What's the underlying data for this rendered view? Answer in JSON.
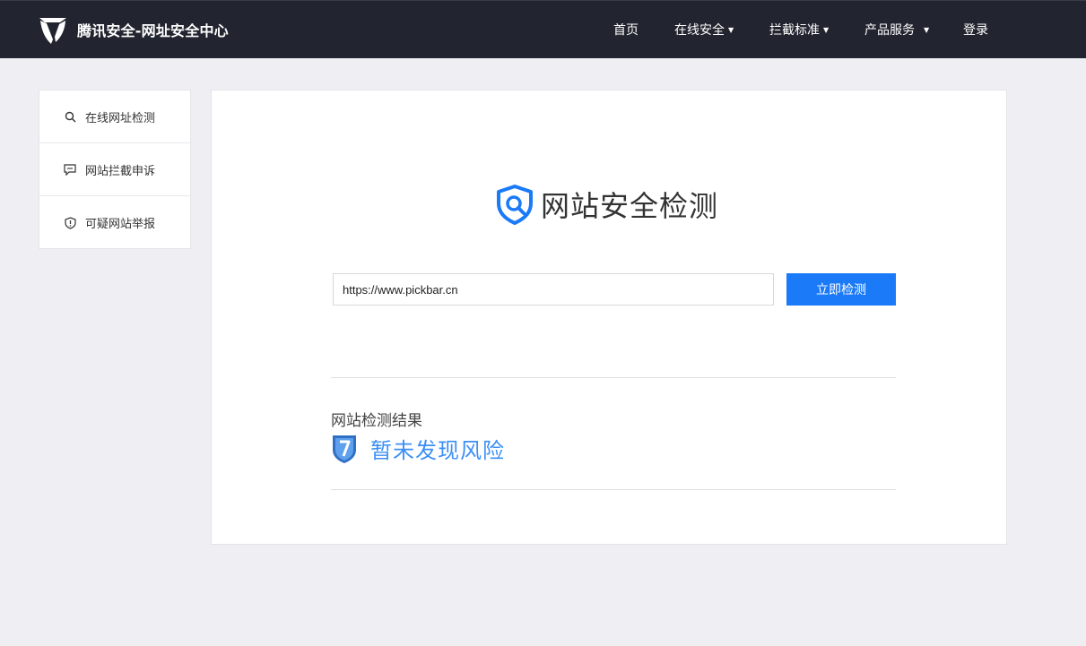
{
  "header": {
    "brand_title": "腾讯安全-网址安全中心",
    "nav": [
      {
        "label": "首页",
        "has_caret": false
      },
      {
        "label": "在线安全",
        "has_caret": true
      },
      {
        "label": "拦截标准",
        "has_caret": true
      },
      {
        "label": "产品服务",
        "has_caret": true
      },
      {
        "label": "登录",
        "has_caret": false
      }
    ],
    "caret_glyph": "▼"
  },
  "sidebar": {
    "items": [
      {
        "label": "在线网址检测",
        "icon": "search-icon"
      },
      {
        "label": "网站拦截申诉",
        "icon": "chat-icon"
      },
      {
        "label": "可疑网站举报",
        "icon": "shield-alert-icon"
      }
    ]
  },
  "main": {
    "heading": "网站安全检测",
    "url_input": {
      "value": "https://www.pickbar.cn"
    },
    "check_button": "立即检测",
    "result_label": "网站检测结果",
    "result_text": "暂未发现风险"
  },
  "colors": {
    "topbar": "#222530",
    "accent": "#1a7af8",
    "result_text": "#3d8ff5",
    "page_bg": "#efeff3"
  }
}
